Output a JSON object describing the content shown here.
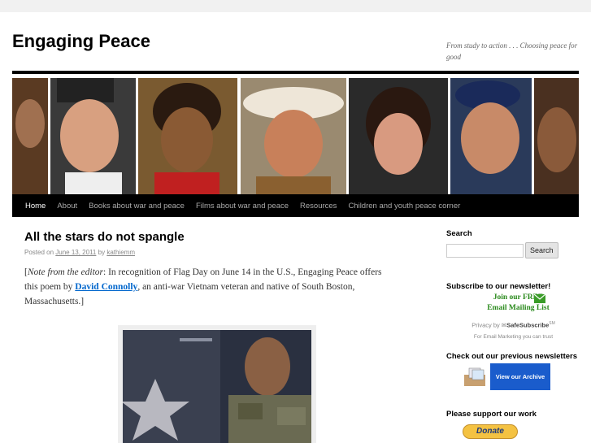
{
  "site": {
    "title": "Engaging Peace",
    "description": "From study to action . . . Choosing peace for good"
  },
  "nav": {
    "items": [
      {
        "label": "Home",
        "current": true
      },
      {
        "label": "About"
      },
      {
        "label": "Books about war and peace"
      },
      {
        "label": "Films about war and peace"
      },
      {
        "label": "Resources"
      },
      {
        "label": "Children and youth peace corner"
      }
    ]
  },
  "post": {
    "title": "All the stars do not spangle",
    "meta_prefix": "Posted on",
    "date": "June 13, 2011",
    "meta_by": "by",
    "author": "kathiemm",
    "intro_bracket_open": "[",
    "intro_italic": "Note from the editor",
    "intro_text_1": ": In recognition of Flag Day on June 14 in the U.S., Engaging Peace offers this poem by ",
    "intro_link": "David Connolly",
    "intro_text_2": ", an anti-war Vietnam veteran and native of South Boston, Massachusetts.]"
  },
  "sidebar": {
    "search_title": "Search",
    "search_button": "Search",
    "search_value": "",
    "newsletter_title": "Subscribe to our newsletter!",
    "join_line1": "Join our FREE",
    "join_line2": "Email Mailing List",
    "privacy_label": "Privacy",
    "privacy_by": "by",
    "safesubscribe": "SafeSubscribe",
    "safesubscribe_sm": "SM",
    "trust_text": "For Email Marketing you can trust",
    "archive_title": "Check out our previous newsletters",
    "archive_button": "View our Archive",
    "support_title": "Please support our work",
    "donate_label": "Donate"
  },
  "colors": {
    "nav_bg": "#000000",
    "link": "#0066cc",
    "join_green": "#2a8a1c",
    "archive_blue": "#1a5ccc"
  }
}
